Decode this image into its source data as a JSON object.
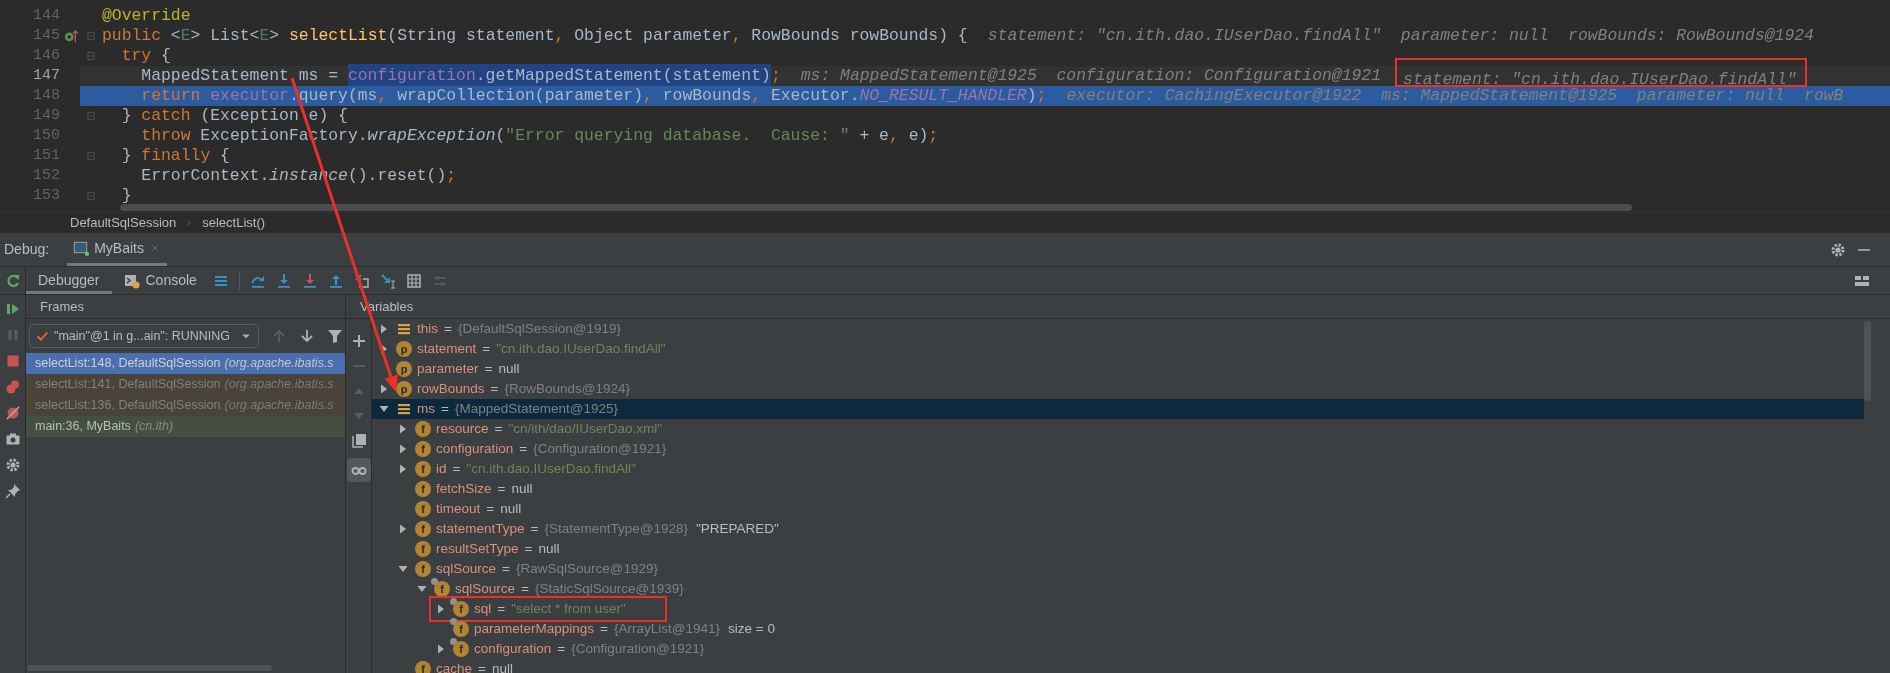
{
  "editor": {
    "lines": [
      {
        "number": "144",
        "kind": "normal",
        "override_marker": false,
        "fold": false,
        "tokens": [
          {
            "text": "@Override",
            "kind": "annotation",
            "selected": false
          }
        ]
      },
      {
        "number": "145",
        "kind": "normal",
        "override_marker": true,
        "fold": true,
        "tokens": [
          {
            "text": "public",
            "kind": "keyword",
            "selected": false
          },
          {
            "text": " <",
            "kind": "plain",
            "selected": false
          },
          {
            "text": "E",
            "kind": "typeparam",
            "selected": false
          },
          {
            "text": "> List<",
            "kind": "plain",
            "selected": false
          },
          {
            "text": "E",
            "kind": "typeparam",
            "selected": false
          },
          {
            "text": "> ",
            "kind": "plain",
            "selected": false
          },
          {
            "text": "selectList",
            "kind": "method",
            "selected": false
          },
          {
            "text": "(String statement",
            "kind": "plain",
            "selected": false
          },
          {
            "text": ", ",
            "kind": "punct",
            "selected": false
          },
          {
            "text": "Object parameter",
            "kind": "plain",
            "selected": false
          },
          {
            "text": ", ",
            "kind": "punct",
            "selected": false
          },
          {
            "text": "RowBounds rowBounds) {",
            "kind": "plain",
            "selected": false
          },
          {
            "text": "statement: \"cn.ith.dao.IUserDao.findAll\"  parameter: null  rowBounds: RowBounds@1924",
            "kind": "hint",
            "selected": false
          }
        ]
      },
      {
        "number": "146",
        "kind": "normal",
        "override_marker": false,
        "fold": true,
        "tokens": [
          {
            "text": "  try",
            "kind": "keyword",
            "selected": false
          },
          {
            "text": " {",
            "kind": "plain",
            "selected": false
          }
        ]
      },
      {
        "number": "147",
        "kind": "caret",
        "override_marker": false,
        "fold": false,
        "tokens": [
          {
            "text": "    MappedStatement ms = ",
            "kind": "plain",
            "selected": false
          },
          {
            "text": "configuration",
            "kind": "field",
            "selected": true
          },
          {
            "text": ".getMappedStatement(statement)",
            "kind": "plain",
            "selected": true
          },
          {
            "text": ";",
            "kind": "punct",
            "selected": false
          },
          {
            "text": "ms: MappedStatement@1925  configuration: Configuration@1921",
            "kind": "hint",
            "selected": false
          },
          {
            "text": "statement: \"cn.ith.dao.IUserDao.findAll\"",
            "kind": "boxed-hint",
            "selected": false
          }
        ]
      },
      {
        "number": "148",
        "kind": "execution",
        "override_marker": false,
        "fold": false,
        "tokens": [
          {
            "text": "    return ",
            "kind": "keyword",
            "selected": false
          },
          {
            "text": "executor",
            "kind": "field",
            "selected": false
          },
          {
            "text": ".query(ms",
            "kind": "plain",
            "selected": false
          },
          {
            "text": ", ",
            "kind": "punct",
            "selected": false
          },
          {
            "text": "wrapCollection(parameter)",
            "kind": "plain",
            "selected": false
          },
          {
            "text": ", ",
            "kind": "punct",
            "selected": false
          },
          {
            "text": "rowBounds",
            "kind": "plain",
            "selected": false
          },
          {
            "text": ", ",
            "kind": "punct",
            "selected": false
          },
          {
            "text": "Executor.",
            "kind": "plain",
            "selected": false
          },
          {
            "text": "NO_RESULT_HANDLER",
            "kind": "static",
            "selected": false
          },
          {
            "text": ")",
            "kind": "plain",
            "selected": false
          },
          {
            "text": ";",
            "kind": "punct",
            "selected": false
          },
          {
            "text": "executor: CachingExecutor@1922  ms: MappedStatement@1925  parameter: null  rowB",
            "kind": "hint",
            "selected": false
          }
        ]
      },
      {
        "number": "149",
        "kind": "normal",
        "override_marker": false,
        "fold": true,
        "tokens": [
          {
            "text": "  } ",
            "kind": "plain",
            "selected": false
          },
          {
            "text": "catch",
            "kind": "keyword",
            "selected": false
          },
          {
            "text": " (Exception e) {",
            "kind": "plain",
            "selected": false
          }
        ]
      },
      {
        "number": "150",
        "kind": "normal",
        "override_marker": false,
        "fold": false,
        "tokens": [
          {
            "text": "    throw",
            "kind": "keyword",
            "selected": false
          },
          {
            "text": " ExceptionFactory.",
            "kind": "plain",
            "selected": false
          },
          {
            "text": "wrapException",
            "kind": "italic",
            "selected": false
          },
          {
            "text": "(",
            "kind": "plain",
            "selected": false
          },
          {
            "text": "\"Error querying database.  Cause: \"",
            "kind": "string",
            "selected": false
          },
          {
            "text": " + e",
            "kind": "plain",
            "selected": false
          },
          {
            "text": ", ",
            "kind": "punct",
            "selected": false
          },
          {
            "text": "e)",
            "kind": "plain",
            "selected": false
          },
          {
            "text": ";",
            "kind": "punct",
            "selected": false
          }
        ]
      },
      {
        "number": "151",
        "kind": "normal",
        "override_marker": false,
        "fold": true,
        "tokens": [
          {
            "text": "  } ",
            "kind": "plain",
            "selected": false
          },
          {
            "text": "finally",
            "kind": "keyword",
            "selected": false
          },
          {
            "text": " {",
            "kind": "plain",
            "selected": false
          }
        ]
      },
      {
        "number": "152",
        "kind": "normal",
        "override_marker": false,
        "fold": false,
        "tokens": [
          {
            "text": "    ErrorContext.",
            "kind": "plain",
            "selected": false
          },
          {
            "text": "instance",
            "kind": "italic",
            "selected": false
          },
          {
            "text": "().reset()",
            "kind": "plain",
            "selected": false
          },
          {
            "text": ";",
            "kind": "punct",
            "selected": false
          }
        ]
      },
      {
        "number": "153",
        "kind": "normal",
        "override_marker": false,
        "fold": true,
        "tokens": [
          {
            "text": "  }",
            "kind": "plain",
            "selected": false
          }
        ]
      }
    ]
  },
  "breadcrumbs": [
    "DefaultSqlSession",
    "selectList()"
  ],
  "debug_bar": {
    "label": "Debug:",
    "tabs": [
      {
        "label": "MyBaits",
        "selected": true
      }
    ]
  },
  "toolbar": {
    "tabs": [
      {
        "label": "Debugger",
        "kind": "debugger",
        "selected": true
      },
      {
        "label": "Console",
        "kind": "console",
        "selected": false
      }
    ],
    "actions": [
      {
        "kind": "menu",
        "disabled": false
      },
      {
        "kind": "step-over",
        "disabled": false
      },
      {
        "kind": "step-into",
        "disabled": false
      },
      {
        "kind": "force-step-into",
        "disabled": false
      },
      {
        "kind": "step-out",
        "disabled": false
      },
      {
        "kind": "drop-frame",
        "disabled": false
      },
      {
        "kind": "run-to-cursor",
        "disabled": false
      },
      {
        "kind": "evaluate",
        "disabled": false
      },
      {
        "kind": "trace",
        "disabled": true
      }
    ]
  },
  "side_toolbar": [
    {
      "kind": "rerun",
      "disabled": false
    },
    {
      "kind": "resume",
      "disabled": false
    },
    {
      "kind": "pause",
      "disabled": true
    },
    {
      "kind": "stop",
      "disabled": false
    },
    {
      "kind": "breakpoints",
      "disabled": false
    },
    {
      "kind": "mute",
      "disabled": false
    },
    {
      "kind": "camera",
      "disabled": false
    },
    {
      "kind": "settings",
      "disabled": false
    },
    {
      "kind": "pin",
      "disabled": false
    }
  ],
  "frames": {
    "title": "Frames",
    "thread": "\"main\"@1 in g...ain\": RUNNING",
    "controls": [
      {
        "kind": "arrow-up",
        "disabled": true
      },
      {
        "kind": "arrow-down",
        "disabled": false
      },
      {
        "kind": "filter",
        "disabled": false
      }
    ],
    "items": [
      {
        "location": "selectList:148, DefaultSqlSession",
        "package": "(org.apache.ibatis.s",
        "kind": "library",
        "selected": true
      },
      {
        "location": "selectList:141, DefaultSqlSession",
        "package": "(org.apache.ibatis.s",
        "kind": "library",
        "selected": false
      },
      {
        "location": "selectList:136, DefaultSqlSession",
        "package": "(org.apache.ibatis.s",
        "kind": "library",
        "selected": false
      },
      {
        "location": "main:36, MyBaits",
        "package": "(cn.ith)",
        "kind": "user",
        "selected": false
      }
    ]
  },
  "variables": {
    "title": "Variables",
    "controls": [
      {
        "kind": "add",
        "disabled": false,
        "on": false
      },
      {
        "kind": "remove",
        "disabled": true,
        "on": false
      },
      {
        "kind": "up",
        "disabled": true,
        "on": false
      },
      {
        "kind": "down",
        "disabled": true,
        "on": false
      },
      {
        "kind": "copy",
        "disabled": false,
        "on": false
      },
      {
        "kind": "glasses",
        "disabled": false,
        "on": true
      }
    ],
    "tree": [
      {
        "kind": "local",
        "name": "this",
        "operator": "=",
        "value": {
          "text": "{DefaultSqlSession@1919}",
          "kind": "object"
        },
        "expandable": true,
        "expanded": false,
        "selected": false,
        "boxed": false
      },
      {
        "kind": "param",
        "icon_text": "p",
        "name": "statement",
        "operator": "=",
        "value": {
          "text": "\"cn.ith.dao.IUserDao.findAll\"",
          "kind": "string"
        },
        "expandable": true,
        "expanded": false,
        "selected": false,
        "boxed": false
      },
      {
        "kind": "param",
        "icon_text": "p",
        "name": "parameter",
        "operator": "=",
        "value": {
          "text": "null",
          "kind": "null"
        },
        "expandable": false,
        "expanded": false,
        "selected": false,
        "boxed": false
      },
      {
        "kind": "param",
        "icon_text": "p",
        "name": "rowBounds",
        "operator": "=",
        "value": {
          "text": "{RowBounds@1924}",
          "kind": "object"
        },
        "expandable": true,
        "expanded": false,
        "selected": false,
        "boxed": false
      },
      {
        "kind": "local",
        "name": "ms",
        "operator": "=",
        "value": {
          "text": "{MappedStatement@1925}",
          "kind": "object"
        },
        "expandable": true,
        "expanded": true,
        "selected": true,
        "boxed": false,
        "children": [
          {
            "kind": "field",
            "icon_text": "f",
            "name": "resource",
            "operator": "=",
            "value": {
              "text": "\"cn/ith/dao/IUserDao.xml\"",
              "kind": "string"
            },
            "expandable": true,
            "expanded": false,
            "selected": false,
            "boxed": false
          },
          {
            "kind": "field",
            "icon_text": "f",
            "name": "configuration",
            "operator": "=",
            "value": {
              "text": "{Configuration@1921}",
              "kind": "object"
            },
            "expandable": true,
            "expanded": false,
            "selected": false,
            "boxed": false
          },
          {
            "kind": "field",
            "icon_text": "f",
            "name": "id",
            "operator": "=",
            "value": {
              "text": "\"cn.ith.dao.IUserDao.findAll\"",
              "kind": "string"
            },
            "expandable": true,
            "expanded": false,
            "selected": false,
            "boxed": false
          },
          {
            "kind": "field",
            "icon_text": "f",
            "name": "fetchSize",
            "operator": "=",
            "value": {
              "text": "null",
              "kind": "null"
            },
            "expandable": false,
            "expanded": false,
            "selected": false,
            "boxed": false
          },
          {
            "kind": "field",
            "icon_text": "f",
            "name": "timeout",
            "operator": "=",
            "value": {
              "text": "null",
              "kind": "null"
            },
            "expandable": false,
            "expanded": false,
            "selected": false,
            "boxed": false
          },
          {
            "kind": "field",
            "icon_text": "f",
            "name": "statementType",
            "operator": "=",
            "value": {
              "text": "{StatementType@1928}",
              "kind": "object"
            },
            "suffix": "\"PREPARED\"",
            "expandable": true,
            "expanded": false,
            "selected": false,
            "boxed": false
          },
          {
            "kind": "field",
            "icon_text": "f",
            "name": "resultSetType",
            "operator": "=",
            "value": {
              "text": "null",
              "kind": "null"
            },
            "expandable": false,
            "expanded": false,
            "selected": false,
            "boxed": false
          },
          {
            "kind": "field",
            "icon_text": "f",
            "name": "sqlSource",
            "operator": "=",
            "value": {
              "text": "{RawSqlSource@1929}",
              "kind": "object"
            },
            "expandable": true,
            "expanded": true,
            "selected": false,
            "boxed": false,
            "children": [
              {
                "kind": "final-field",
                "icon_text": "f",
                "name": "sqlSource",
                "operator": "=",
                "value": {
                  "text": "{StaticSqlSource@1939}",
                  "kind": "object"
                },
                "expandable": true,
                "expanded": true,
                "selected": false,
                "boxed": false,
                "children": [
                  {
                    "kind": "final-field",
                    "icon_text": "f",
                    "name": "sql",
                    "operator": "=",
                    "value": {
                      "text": "\"select * from user\"",
                      "kind": "string"
                    },
                    "expandable": true,
                    "expanded": false,
                    "selected": false,
                    "boxed": true
                  },
                  {
                    "kind": "final-field",
                    "icon_text": "f",
                    "name": "parameterMappings",
                    "operator": "=",
                    "value": {
                      "text": "{ArrayList@1941}",
                      "kind": "object"
                    },
                    "suffix": "size = 0",
                    "expandable": false,
                    "expanded": false,
                    "selected": false,
                    "boxed": false
                  },
                  {
                    "kind": "final-field",
                    "icon_text": "f",
                    "name": "configuration",
                    "operator": "=",
                    "value": {
                      "text": "{Configuration@1921}",
                      "kind": "object"
                    },
                    "expandable": true,
                    "expanded": false,
                    "selected": false,
                    "boxed": false
                  }
                ]
              }
            ]
          },
          {
            "kind": "field",
            "icon_text": "f",
            "name": "cache",
            "operator": "=",
            "value": {
              "text": "null",
              "kind": "null"
            },
            "expandable": false,
            "expanded": false,
            "selected": false,
            "boxed": false
          }
        ]
      }
    ]
  }
}
